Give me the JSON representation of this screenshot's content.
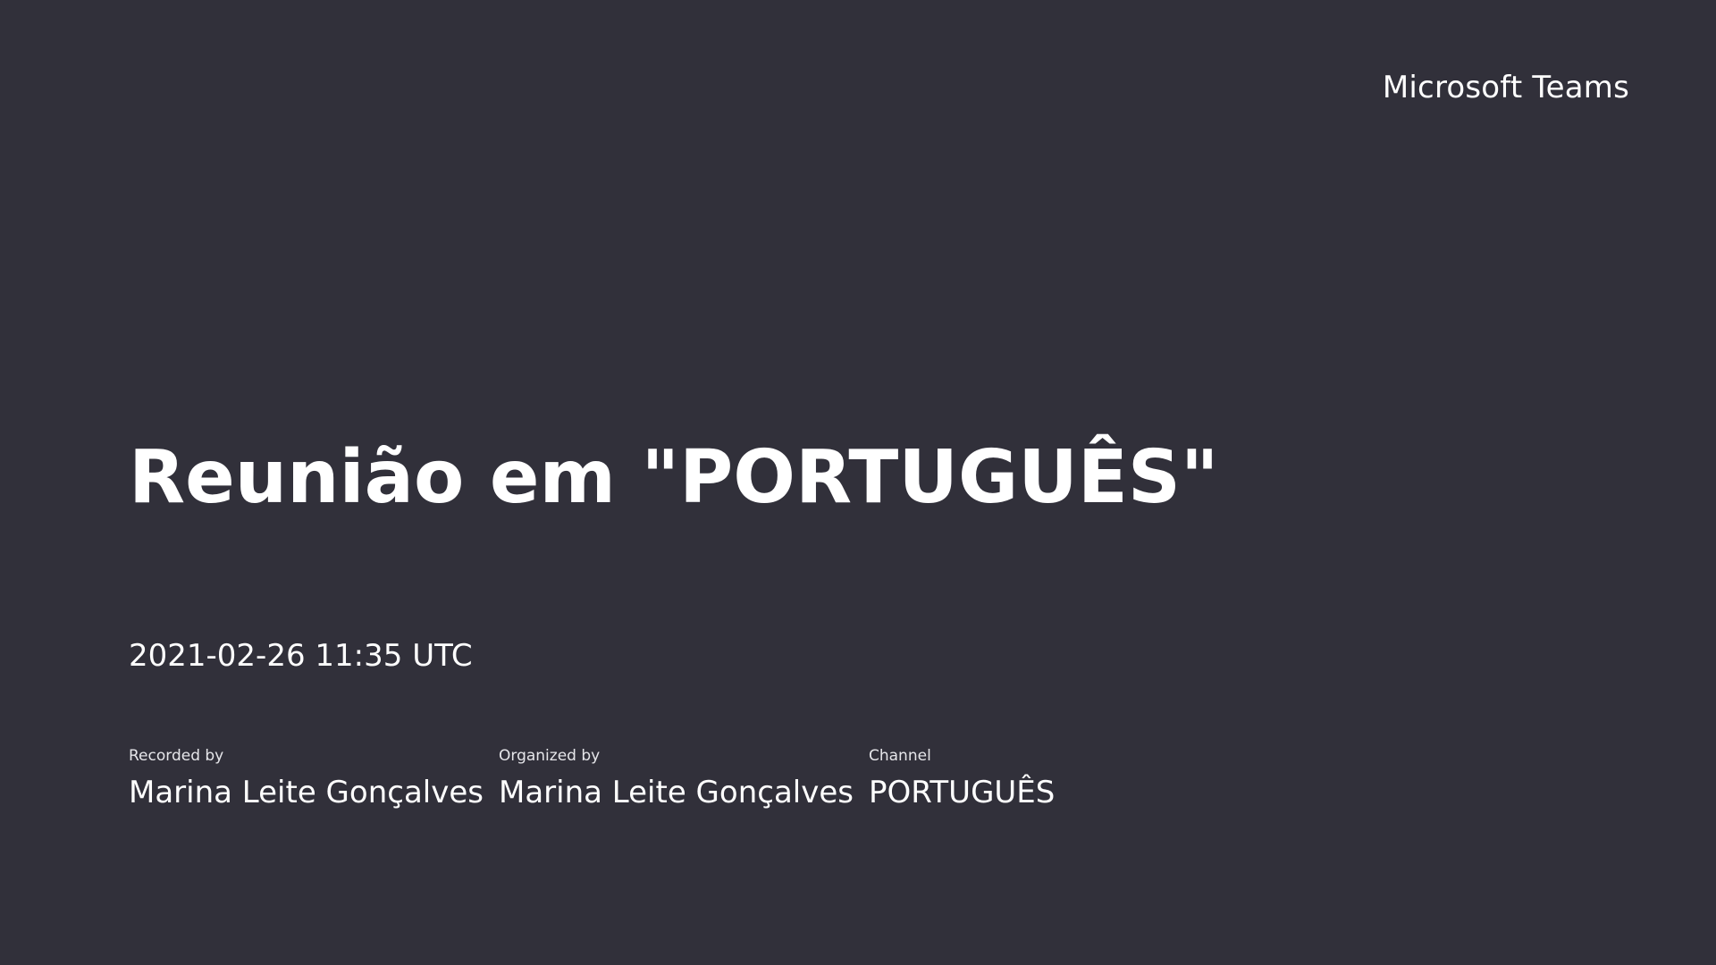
{
  "brand": {
    "label": "Microsoft Teams"
  },
  "meeting": {
    "title": "Reunião em \"PORTUGUÊS\"",
    "datetime": "2021-02-26 11:35 UTC"
  },
  "details": {
    "recorded_by": {
      "label": "Recorded by",
      "value": "Marina Leite Gonçalves"
    },
    "organized_by": {
      "label": "Organized by",
      "value": "Marina Leite Gonçalves"
    },
    "channel": {
      "label": "Channel",
      "value": "PORTUGUÊS"
    }
  },
  "colors": {
    "background": "#31303a",
    "text": "#ffffff",
    "label_text": "#e6e6ea"
  }
}
